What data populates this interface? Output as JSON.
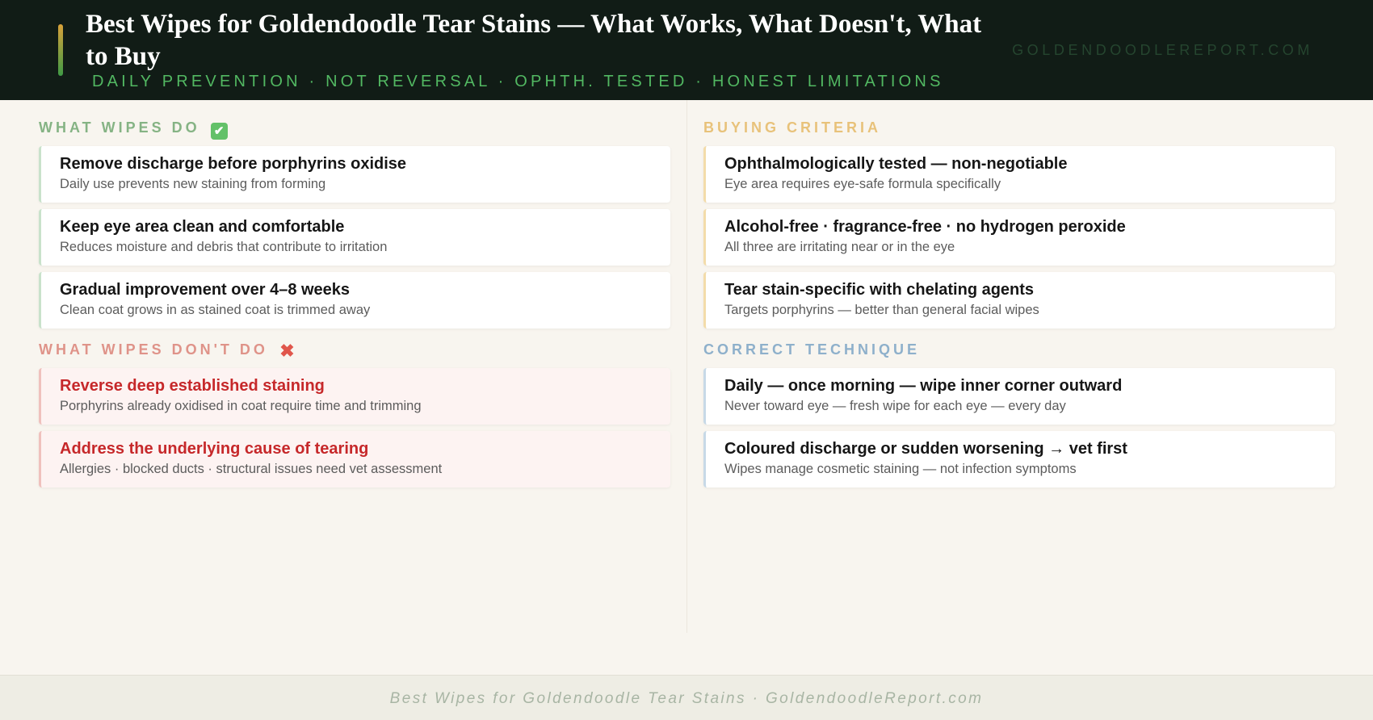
{
  "header": {
    "title": "Best Wipes for Goldendoodle Tear Stains — What Works, What Doesn't, What to Buy",
    "subtitle": "DAILY PREVENTION · NOT REVERSAL · OPHTH. TESTED · HONEST LIMITATIONS",
    "site": "GOLDENDOODLEREPORT.COM"
  },
  "sections": {
    "do": {
      "heading": "WHAT WIPES DO",
      "emoji": "✔",
      "items": [
        {
          "title": "Remove discharge before porphyrins oxidise",
          "sub": "Daily use prevents new staining from forming"
        },
        {
          "title": "Keep eye area clean and comfortable",
          "sub": "Reduces moisture and debris that contribute to irritation"
        },
        {
          "title": "Gradual improvement over 4–8 weeks",
          "sub": "Clean coat grows in as stained coat is trimmed away"
        }
      ]
    },
    "dont": {
      "heading": "WHAT WIPES DON'T DO",
      "emoji": "✖",
      "items": [
        {
          "title": "Reverse deep established staining",
          "sub": "Porphyrins already oxidised in coat require time and trimming"
        },
        {
          "title": "Address the underlying cause of tearing",
          "sub": "Allergies · blocked ducts · structural issues need vet assessment"
        }
      ]
    },
    "criteria": {
      "heading": "BUYING CRITERIA",
      "items": [
        {
          "title": "Ophthalmologically tested — non-negotiable",
          "sub": "Eye area requires eye-safe formula specifically"
        },
        {
          "title": "Alcohol-free · fragrance-free · no hydrogen peroxide",
          "sub": "All three are irritating near or in the eye"
        },
        {
          "title": "Tear stain-specific with chelating agents",
          "sub": "Targets porphyrins — better than general facial wipes"
        }
      ]
    },
    "technique": {
      "heading": "CORRECT TECHNIQUE",
      "items": [
        {
          "title": "Daily — once morning — wipe inner corner outward",
          "sub": "Never toward eye — fresh wipe for each eye — every day"
        },
        {
          "title": "Coloured discharge or sudden worsening → vet first",
          "sub": "Wipes manage cosmetic staining — not infection symptoms"
        }
      ]
    }
  },
  "footer": {
    "text": "Best Wipes for Goldendoodle Tear Stains · GoldendoodleReport.com"
  },
  "colors": {
    "header_bg": "#111c16",
    "accent_green": "#52b862",
    "do_heading": "#85b384",
    "dont_heading": "#df9389",
    "criteria_heading": "#e8c27a",
    "technique_heading": "#8eb0cb",
    "dont_title": "#c6282a"
  }
}
